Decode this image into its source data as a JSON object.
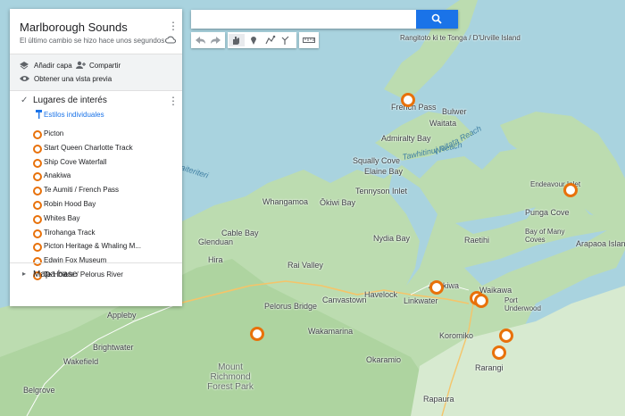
{
  "map_title": "Marlborough Sounds",
  "last_change": "El último cambio se hizo hace unos segundos",
  "actions": {
    "add_layer": "Añadir capa",
    "share": "Compartir",
    "preview": "Obtener una vista previa"
  },
  "layer": {
    "name": "Lugares de interés",
    "styles_label": "Estilos individuales",
    "places": [
      "Picton",
      "Start Queen Charlotte Track",
      "Ship Cove Waterfall",
      "Anakiwa",
      "Te Aumiti / French Pass",
      "Robin Hood Bay",
      "Whites Bay",
      "Tirohanga Track",
      "Picton Heritage & Whaling M...",
      "Edwin Fox Museum",
      "Te Hoiere / Pelorus River"
    ]
  },
  "basemap_label": "Mapa base",
  "search": {
    "value": "",
    "placeholder": ""
  },
  "colors": {
    "marker": "#e8710a",
    "water": "#a9d3df",
    "land": "#bcdcb0",
    "accent": "#1a73e8"
  },
  "map_labels": [
    "Rangitoto ki te Tonga / D'Urville Island",
    "French Pass",
    "Bulwer",
    "Waitata",
    "Admiralty Bay",
    "Waitata Reach",
    "Squally Cove",
    "Elaine Bay",
    "Tawhitinui Reach",
    "Tennyson Inlet",
    "Endeavour Inlet",
    "Punga Cove",
    "Ōkiwi Bay",
    "Whangamoa",
    "Glenduan",
    "Cable Bay",
    "Nydia Bay",
    "Raetihi",
    "Bay of Many Coves",
    "Arapaoa Island",
    "Hira",
    "Rai Valley",
    "Pelorus Bridge",
    "Canvastown",
    "Havelock",
    "Linkwater",
    "Anakiwa",
    "Waikawa",
    "Port Underwood",
    "Koromiko",
    "Wakamarina",
    "Okaramio",
    "Rarangi",
    "Rapaura",
    "Appleby",
    "Brightwater",
    "Wakefield",
    "Belgrove",
    "Mount Richmond Forest Park",
    "Kaiteriteri"
  ]
}
